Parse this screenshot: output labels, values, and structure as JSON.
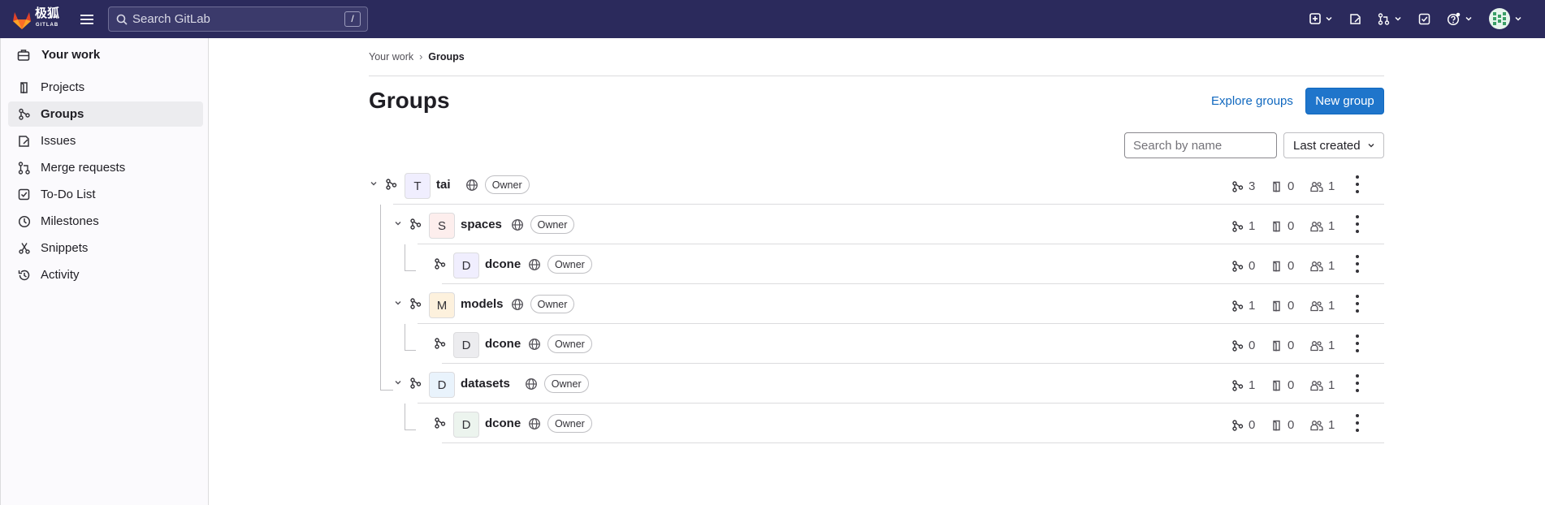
{
  "topbar": {
    "logo_text": "极狐",
    "logo_sub": "GITLAB",
    "search_placeholder": "Search GitLab",
    "search_shortcut": "/"
  },
  "sidebar": {
    "header": "Your work",
    "items": [
      {
        "label": "Projects",
        "icon": "project-icon"
      },
      {
        "label": "Groups",
        "icon": "group-icon",
        "active": true
      },
      {
        "label": "Issues",
        "icon": "issues-icon"
      },
      {
        "label": "Merge requests",
        "icon": "merge-request-icon"
      },
      {
        "label": "To-Do List",
        "icon": "todo-icon"
      },
      {
        "label": "Milestones",
        "icon": "milestone-icon"
      },
      {
        "label": "Snippets",
        "icon": "snippet-icon"
      },
      {
        "label": "Activity",
        "icon": "history-icon"
      }
    ]
  },
  "breadcrumb": {
    "parent": "Your work",
    "current": "Groups"
  },
  "page": {
    "title": "Groups",
    "explore_label": "Explore groups",
    "new_group_label": "New group",
    "search_placeholder": "Search by name",
    "sort_label": "Last created"
  },
  "groups": [
    {
      "avatar": "T",
      "name": "tai",
      "role": "Owner",
      "subgroups": "3",
      "projects": "0",
      "members": "1",
      "depth": 0,
      "expandable": true,
      "avatar_bg": "#f0eefe"
    },
    {
      "avatar": "S",
      "name": "spaces",
      "role": "Owner",
      "subgroups": "1",
      "projects": "0",
      "members": "1",
      "depth": 1,
      "expandable": true,
      "avatar_bg": "#fdeeed"
    },
    {
      "avatar": "D",
      "name": "dcone",
      "role": "Owner",
      "subgroups": "0",
      "projects": "0",
      "members": "1",
      "depth": 2,
      "expandable": false,
      "avatar_bg": "#f0eefe"
    },
    {
      "avatar": "M",
      "name": "models",
      "role": "Owner",
      "subgroups": "1",
      "projects": "0",
      "members": "1",
      "depth": 1,
      "expandable": true,
      "avatar_bg": "#fdf1dd"
    },
    {
      "avatar": "D",
      "name": "dcone",
      "role": "Owner",
      "subgroups": "0",
      "projects": "0",
      "members": "1",
      "depth": 2,
      "expandable": false,
      "avatar_bg": "#ececef"
    },
    {
      "avatar": "D",
      "name": "datasets",
      "role": "Owner",
      "subgroups": "1",
      "projects": "0",
      "members": "1",
      "depth": 1,
      "expandable": true,
      "avatar_bg": "#e9f3fc"
    },
    {
      "avatar": "D",
      "name": "dcone",
      "role": "Owner",
      "subgroups": "0",
      "projects": "0",
      "members": "1",
      "depth": 2,
      "expandable": false,
      "avatar_bg": "#ecf4ee"
    }
  ],
  "colors": {
    "topbar": "#2b2a5c",
    "primary": "#1f75cb",
    "link": "#1068bf"
  }
}
